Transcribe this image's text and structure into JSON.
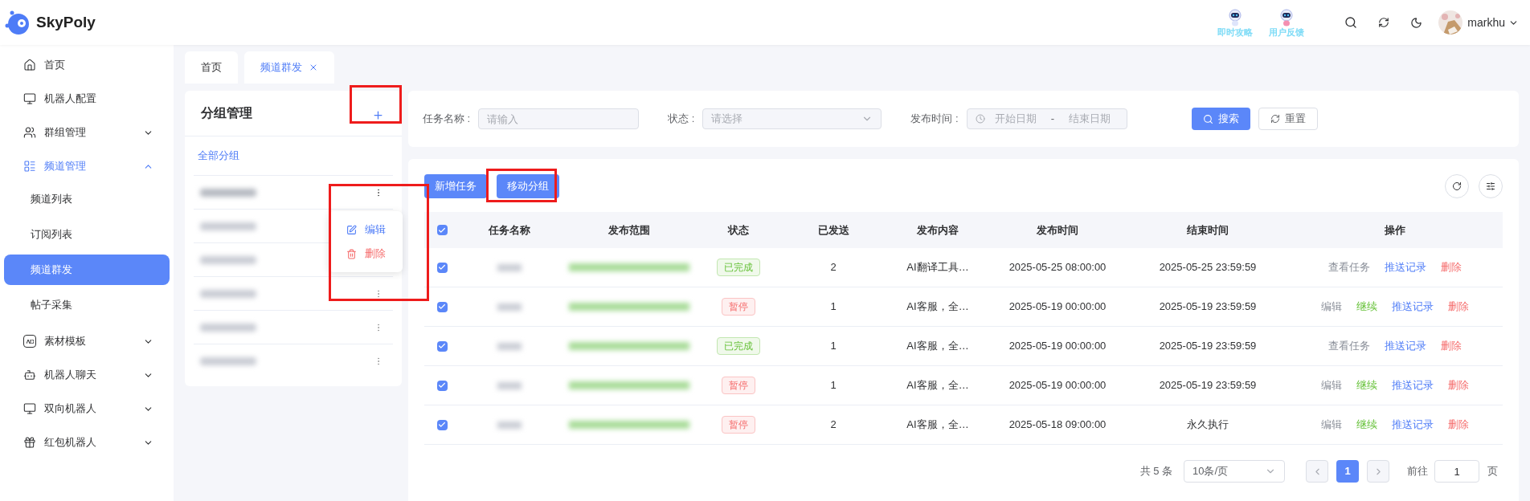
{
  "brand": {
    "name": "SkyPoly"
  },
  "header": {
    "promos": [
      "即时攻略",
      "用户反馈"
    ],
    "user": "markhu"
  },
  "sidebar": {
    "items": [
      {
        "label": "首页",
        "selected": false
      },
      {
        "label": "机器人配置",
        "selected": false
      },
      {
        "label": "群组管理",
        "expanded": false,
        "selected": false
      },
      {
        "label": "频道管理",
        "expanded": true,
        "selected": false,
        "children": [
          {
            "label": "频道列表",
            "selected": false
          },
          {
            "label": "订阅列表",
            "selected": false
          },
          {
            "label": "频道群发",
            "selected": true
          },
          {
            "label": "帖子采集",
            "selected": false
          }
        ]
      },
      {
        "label": "素材模板",
        "expanded": false,
        "selected": false
      },
      {
        "label": "机器人聊天",
        "expanded": false,
        "selected": false
      },
      {
        "label": "双向机器人",
        "expanded": false,
        "selected": false
      },
      {
        "label": "红包机器人",
        "expanded": false,
        "selected": false
      }
    ]
  },
  "tabs": [
    {
      "label": "首页",
      "selected": false,
      "closable": false
    },
    {
      "label": "频道群发",
      "selected": true,
      "closable": true
    }
  ],
  "groups": {
    "title": "分组管理",
    "all_label": "全部分组",
    "items": [
      {
        "menu_open": true
      },
      {
        "menu_open": false
      },
      {
        "menu_open": false
      },
      {
        "menu_open": false
      },
      {
        "menu_open": false
      },
      {
        "menu_open": false
      }
    ],
    "menu": [
      {
        "label": "编辑",
        "kind": "edit"
      },
      {
        "label": "删除",
        "kind": "delete"
      }
    ]
  },
  "filters": [
    {
      "label": "任务名称 :",
      "kind": "text",
      "placeholder": "请输入"
    },
    {
      "label": "状态 :",
      "kind": "select",
      "placeholder": "请选择"
    },
    {
      "label": "发布时间 :",
      "kind": "daterange",
      "placeholder": "开始日期",
      "placeholder_end": "结束日期",
      "separator": "-"
    }
  ],
  "filter_buttons": [
    {
      "label": "搜索",
      "kind": "primary"
    },
    {
      "label": "重置",
      "kind": "default"
    }
  ],
  "toolbar": [
    "新增任务",
    "移动分组"
  ],
  "table": {
    "columns": [
      "任务名称",
      "发布范围",
      "状态",
      "已发送",
      "发布内容",
      "发布时间",
      "结束时间",
      "操作"
    ],
    "all_checked": true,
    "rows": [
      {
        "checked": true,
        "status": {
          "label": "已完成",
          "kind": "done"
        },
        "sent": "2",
        "content": "AI翻译工具…",
        "publish_time": "2025-05-25 08:00:00",
        "end_time": "2025-05-25 23:59:59",
        "actions": [
          {
            "label": "查看任务",
            "kind": "view"
          },
          {
            "label": "推送记录",
            "kind": "link"
          },
          {
            "label": "删除",
            "kind": "delete"
          }
        ]
      },
      {
        "checked": true,
        "status": {
          "label": "暂停",
          "kind": "paused"
        },
        "sent": "1",
        "content": "AI客服，全…",
        "publish_time": "2025-05-19 00:00:00",
        "end_time": "2025-05-19 23:59:59",
        "actions": [
          {
            "label": "编辑",
            "kind": "view"
          },
          {
            "label": "继续",
            "kind": "resume"
          },
          {
            "label": "推送记录",
            "kind": "link"
          },
          {
            "label": "删除",
            "kind": "delete"
          }
        ]
      },
      {
        "checked": true,
        "status": {
          "label": "已完成",
          "kind": "done"
        },
        "sent": "1",
        "content": "AI客服，全…",
        "publish_time": "2025-05-19 00:00:00",
        "end_time": "2025-05-19 23:59:59",
        "actions": [
          {
            "label": "查看任务",
            "kind": "view"
          },
          {
            "label": "推送记录",
            "kind": "link"
          },
          {
            "label": "删除",
            "kind": "delete"
          }
        ]
      },
      {
        "checked": true,
        "status": {
          "label": "暂停",
          "kind": "paused"
        },
        "sent": "1",
        "content": "AI客服，全…",
        "publish_time": "2025-05-19 00:00:00",
        "end_time": "2025-05-19 23:59:59",
        "actions": [
          {
            "label": "编辑",
            "kind": "view"
          },
          {
            "label": "继续",
            "kind": "resume"
          },
          {
            "label": "推送记录",
            "kind": "link"
          },
          {
            "label": "删除",
            "kind": "delete"
          }
        ]
      },
      {
        "checked": true,
        "status": {
          "label": "暂停",
          "kind": "paused"
        },
        "sent": "2",
        "content": "AI客服，全…",
        "publish_time": "2025-05-18 09:00:00",
        "end_time": "永久执行",
        "actions": [
          {
            "label": "编辑",
            "kind": "view"
          },
          {
            "label": "继续",
            "kind": "resume"
          },
          {
            "label": "推送记录",
            "kind": "link"
          },
          {
            "label": "删除",
            "kind": "delete"
          }
        ]
      }
    ]
  },
  "pagination": {
    "total": "共 5 条",
    "page_size": "10条/页",
    "pages": [
      {
        "label": "1",
        "selected": true
      }
    ],
    "goto_label": "前往",
    "goto_value": "1",
    "page_unit": "页"
  }
}
